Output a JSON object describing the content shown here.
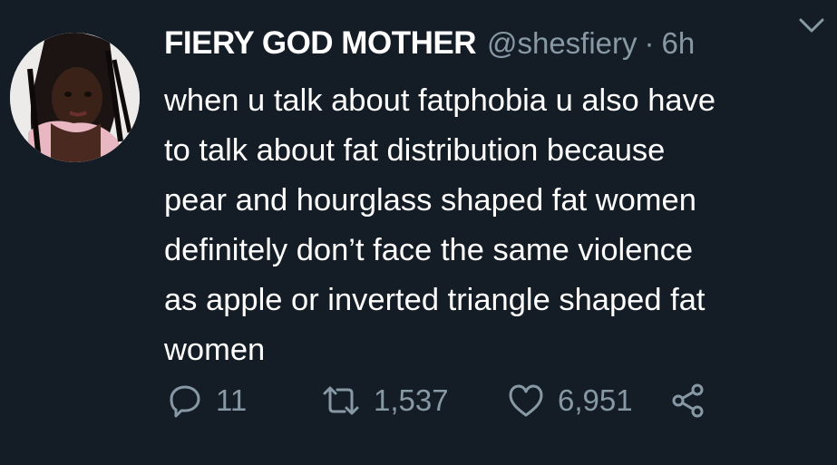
{
  "tweet": {
    "display_name": "FIERY GOD MOTHER",
    "handle": "@shesfiery",
    "separator": "·",
    "time": "6h",
    "text_lines": [
      "when u talk about fatphobia u also have",
      "to talk about fat distribution  because",
      "pear and hourglass shaped fat women",
      "definitely don’t face the same violence",
      "as apple or inverted triangle shaped fat",
      "women"
    ],
    "replies": "11",
    "retweets": "1,537",
    "likes": "6,951"
  },
  "icons": {
    "menu": "chevron-down-icon",
    "reply": "reply-icon",
    "retweet": "retweet-icon",
    "like": "heart-icon",
    "share": "share-icon"
  },
  "colors": {
    "background": "#141d26",
    "text": "#ffffff",
    "secondary": "#8899a6"
  }
}
